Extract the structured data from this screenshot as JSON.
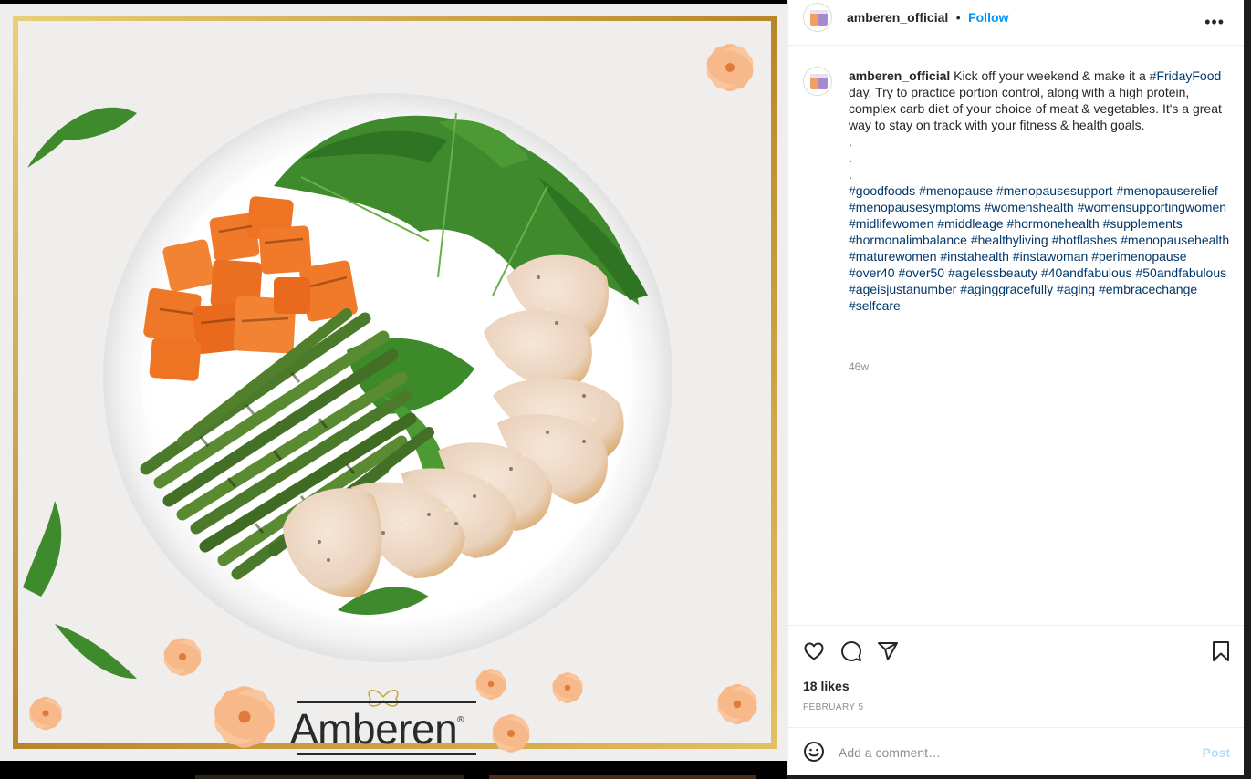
{
  "post": {
    "username": "amberen_official",
    "follow_label": "Follow",
    "separator": "•",
    "more_icon": "more-horizontal-icon",
    "caption_author": "amberen_official",
    "caption_lines": [
      "Kick off your weekend & make it a",
      "#FridayFood",
      "day. Try to practice portion control, along with a high protein, complex carb diet of your choice of meat & vegetables. It's a great way to stay on track with your fitness & health goals."
    ],
    "dots": [
      ".",
      ".",
      "."
    ],
    "hashtags": [
      "#goodfoods",
      "#menopause",
      "#menopausesupport",
      "#menopauserelief",
      "#menopausesymptoms",
      "#womenshealth",
      "#womensupportingwomen",
      "#midlifewomen",
      "#middleage",
      "#hormonehealth",
      "#supplements",
      "#hormonalimbalance",
      "#healthyliving",
      "#hotflashes",
      "#menopausehealth",
      "#maturewomen",
      "#instahealth",
      "#instawoman",
      "#perimenopause",
      "#over40",
      "#over50",
      "#agelessbeauty",
      "#40andfabulous",
      "#50andfabulous",
      "#ageisjustanumber",
      "#aginggracefully",
      "#aging",
      "#embracechange",
      "#selfcare"
    ],
    "time_ago": "46w",
    "likes": "18 likes",
    "date": "FEBRUARY 5",
    "comment_placeholder": "Add a comment…",
    "post_label": "Post"
  },
  "image": {
    "brand": "Amberen",
    "brand_mark": "®"
  },
  "colors": {
    "link": "#0095f6",
    "hashtag": "#00376b",
    "gold_frame": "#c9a33a",
    "sweet_potato": "#f07a2a",
    "green_bean": "#4a7a2a",
    "flower": "#f7b98a"
  }
}
